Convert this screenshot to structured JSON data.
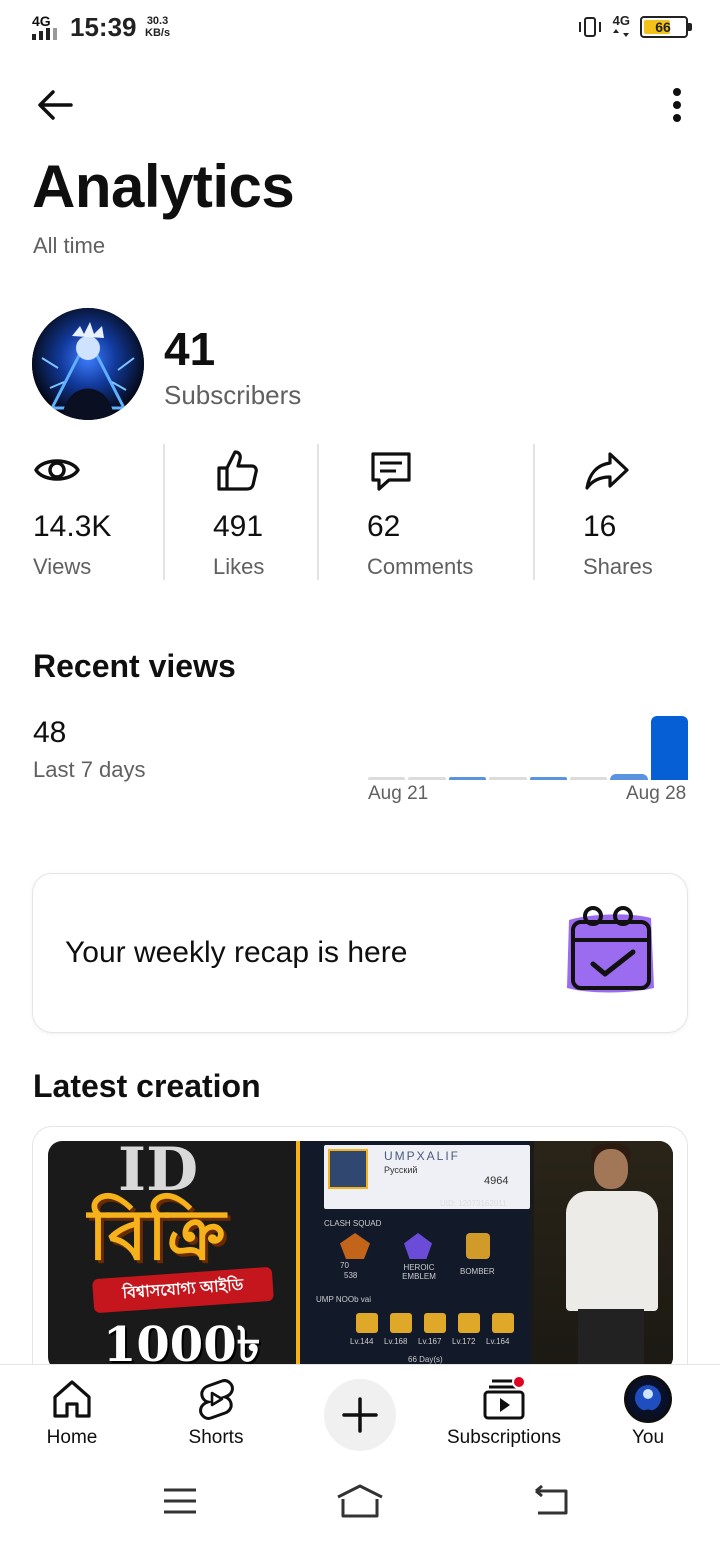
{
  "status_bar": {
    "network_left": "4G",
    "time": "15:39",
    "speed_value": "30.3",
    "speed_unit": "KB/s",
    "network_right": "4G",
    "battery": "66"
  },
  "header": {
    "title": "Analytics",
    "subtitle": "All time",
    "back_icon": "arrow-back-icon",
    "more_icon": "more-vertical-icon"
  },
  "channel": {
    "subscriber_count": "41",
    "subscriber_label": "Subscribers"
  },
  "stats": [
    {
      "icon": "eye-icon",
      "value": "14.3K",
      "label": "Views"
    },
    {
      "icon": "thumbs-up-icon",
      "value": "491",
      "label": "Likes"
    },
    {
      "icon": "comment-icon",
      "value": "62",
      "label": "Comments"
    },
    {
      "icon": "share-icon",
      "value": "16",
      "label": "Shares"
    }
  ],
  "recent_views": {
    "title": "Recent views",
    "count": "48",
    "period": "Last 7 days",
    "axis_start": "Aug 21",
    "axis_end": "Aug 28"
  },
  "chart_data": {
    "type": "bar",
    "x_start": "Aug 21",
    "x_end": "Aug 28",
    "values": [
      0,
      0,
      1,
      0,
      1,
      0,
      4,
      42
    ],
    "title": "",
    "xlabel": "",
    "ylabel": ""
  },
  "recap": {
    "text": "Your weekly recap is here",
    "icon": "calendar-check-icon"
  },
  "latest_creation": {
    "title": "Latest creation",
    "thumbnail": {
      "headline_top": "ID",
      "headline": "বিক্রি",
      "banner": "বিশ্বাসযোগ্য আইডি",
      "price": "1000৳",
      "player_name": "UMPXALIF",
      "player_sub": "Русский",
      "likes": "4964",
      "uid": "UID: 12073162011",
      "squad_label": "CLASH SQUAD",
      "badge_1_value": "70",
      "badge_1_sub": "538",
      "badge_2": "HEROIC EMBLEM",
      "badge_3": "BOMBER",
      "guild": "UMP NOOb vai",
      "levels": [
        "Lv.144",
        "Lv.168",
        "Lv.167",
        "Lv.172",
        "Lv.164"
      ],
      "days": "66 Day(s)"
    }
  },
  "bottom_nav": [
    {
      "label": "Home",
      "icon": "home-icon"
    },
    {
      "label": "Shorts",
      "icon": "shorts-icon"
    },
    {
      "label": "",
      "icon": "create-plus-icon"
    },
    {
      "label": "Subscriptions",
      "icon": "subscriptions-icon"
    },
    {
      "label": "You",
      "icon": "avatar-icon"
    }
  ],
  "colors": {
    "bar_active": "#065fd4",
    "bar_light": "#5a93e0",
    "bar_zero": "#dcdcdc",
    "secondary_text": "#606060",
    "notification": "#e00022",
    "recap_purple": "#9b6cf0"
  }
}
